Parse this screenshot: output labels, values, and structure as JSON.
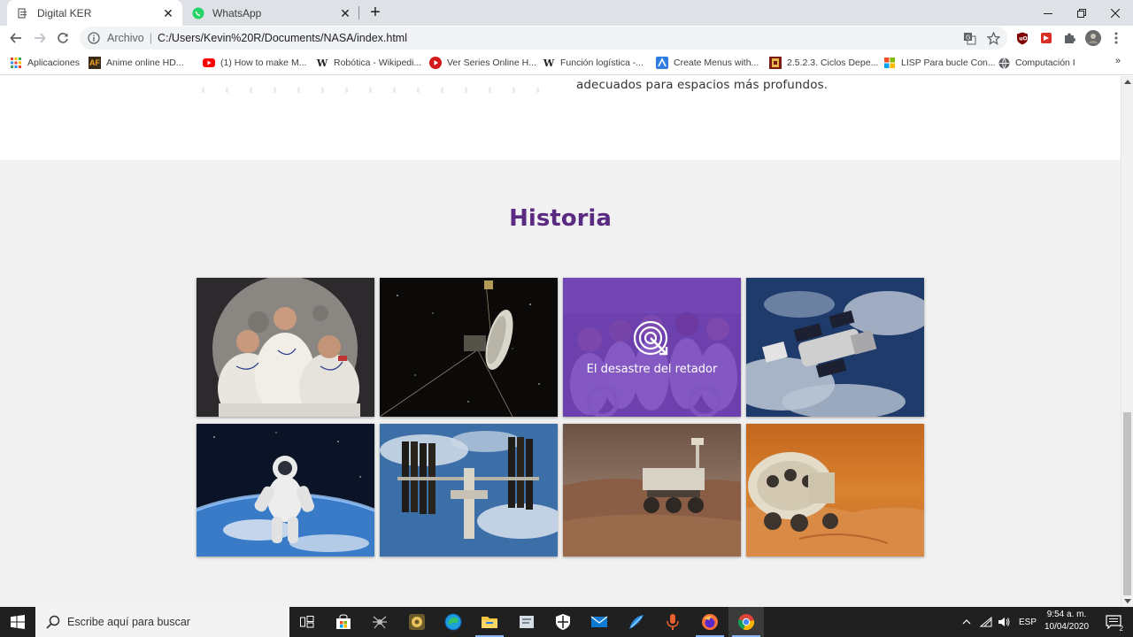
{
  "browser": {
    "tabs": [
      {
        "title": "Digital KER",
        "active": true
      },
      {
        "title": "WhatsApp",
        "active": false
      }
    ],
    "omnibox": {
      "scheme": "Archivo",
      "url": "C:/Users/Kevin%20R/Documents/NASA/index.html"
    },
    "bookmarks": [
      {
        "label": "Aplicaciones",
        "icon": "apps-grid-icon"
      },
      {
        "label": "Anime online HD...",
        "icon": "anime-icon"
      },
      {
        "label": "(1) How to make M...",
        "icon": "youtube-icon"
      },
      {
        "label": "Robótica - Wikipedi...",
        "icon": "wikipedia-icon"
      },
      {
        "label": "Ver Series Online H...",
        "icon": "play-icon"
      },
      {
        "label": "Función logística -...",
        "icon": "wikipedia-icon"
      },
      {
        "label": "Create Menus with...",
        "icon": "arrow-icon"
      },
      {
        "label": "2.5.2.3. Ciclos Depe...",
        "icon": "book-icon"
      },
      {
        "label": "LISP Para bucle Con...",
        "icon": "windows-logo-icon"
      },
      {
        "label": "Computación I",
        "icon": "globe-icon"
      }
    ],
    "more_bookmarks": "»"
  },
  "page": {
    "about_text": "adecuados para espacios más profundos.",
    "section_title": "Historia",
    "gallery": [
      {
        "scene": "apollo-crew-photo"
      },
      {
        "scene": "voyager-probe"
      },
      {
        "scene": "challenger-crew",
        "hover_label": "El desastre del retador"
      },
      {
        "scene": "hubble-telescope"
      },
      {
        "scene": "spacewalk-astronaut"
      },
      {
        "scene": "space-station"
      },
      {
        "scene": "mars-rover"
      },
      {
        "scene": "mars-vehicle"
      }
    ]
  },
  "taskbar": {
    "search_placeholder": "Escribe aquí para buscar",
    "language": "ESP",
    "time": "9:54 a. m.",
    "date": "10/04/2020",
    "notifications": "2"
  },
  "colors": {
    "title_purple": "#5b2a83",
    "overlay_purple": "#6c34be",
    "page_bg": "#f1f1f1"
  }
}
